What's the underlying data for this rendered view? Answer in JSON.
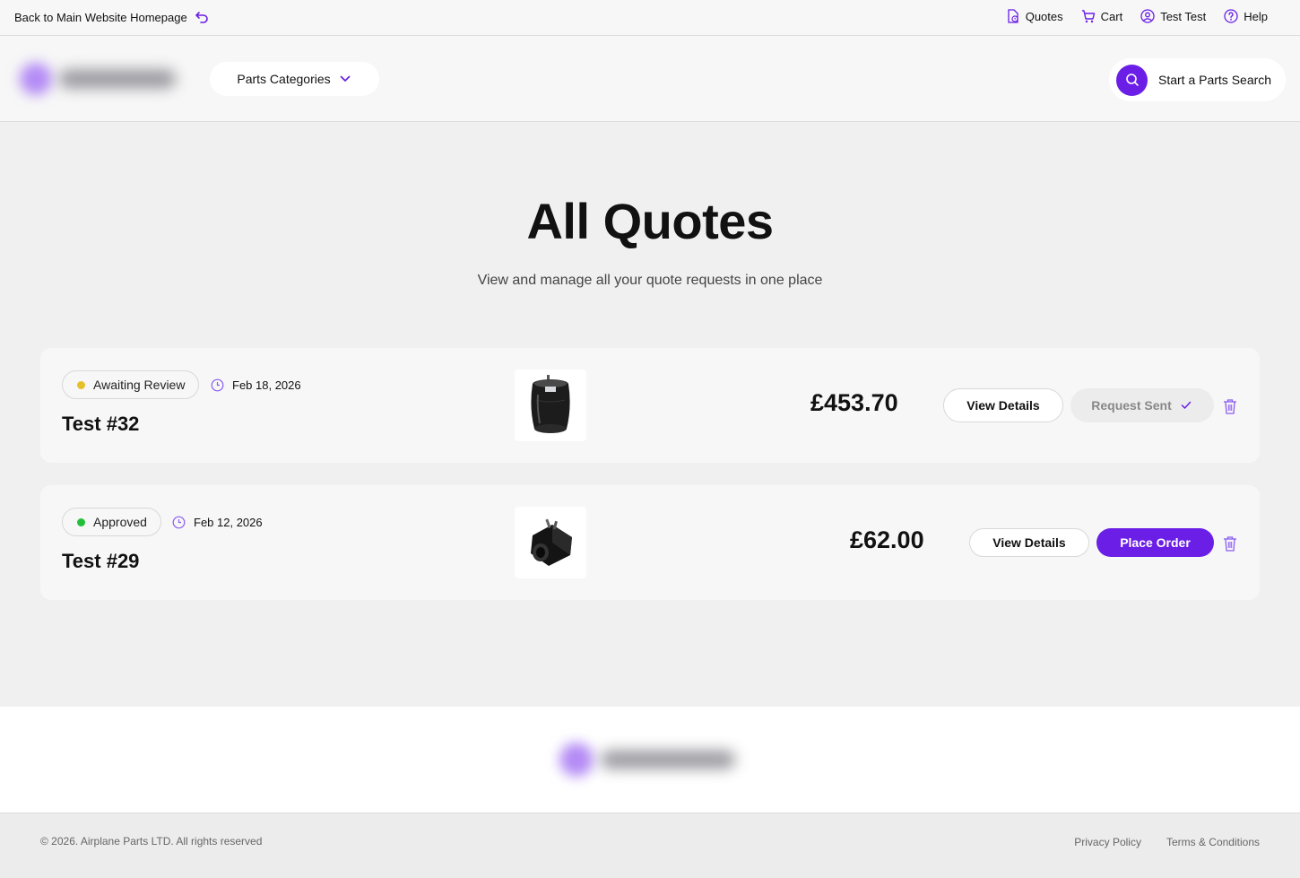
{
  "topbar": {
    "back_label": "Back to Main Website Homepage",
    "nav": [
      {
        "label": "Quotes",
        "icon": "quote-document-icon"
      },
      {
        "label": "Cart",
        "icon": "cart-icon"
      },
      {
        "label": "Test Test",
        "icon": "user-icon"
      },
      {
        "label": "Help",
        "icon": "help-icon"
      }
    ]
  },
  "header": {
    "categories_label": "Parts Categories",
    "search_label": "Start a Parts Search"
  },
  "main": {
    "title": "All Quotes",
    "subtitle": "View and manage all your quote requests in one place"
  },
  "quotes": [
    {
      "status": "Awaiting Review",
      "status_color": "#e6c02a",
      "date": "Feb 18, 2026",
      "title": "Test #32",
      "image": "air-spring-part-image",
      "price": "£453.70",
      "view_label": "View Details",
      "action_label": "Request Sent",
      "action_state": "sent"
    },
    {
      "status": "Approved",
      "status_color": "#22c03a",
      "date": "Feb 12, 2026",
      "title": "Test #29",
      "image": "solenoid-coil-part-image",
      "price": "£62.00",
      "view_label": "View Details",
      "action_label": "Place Order",
      "action_state": "primary"
    }
  ],
  "footer": {
    "copyright": "© 2026. Airplane Parts LTD. All rights reserved",
    "links": [
      "Privacy Policy",
      "Terms & Conditions"
    ]
  },
  "colors": {
    "accent": "#6a1ee6",
    "background": "#f0f0f0"
  }
}
